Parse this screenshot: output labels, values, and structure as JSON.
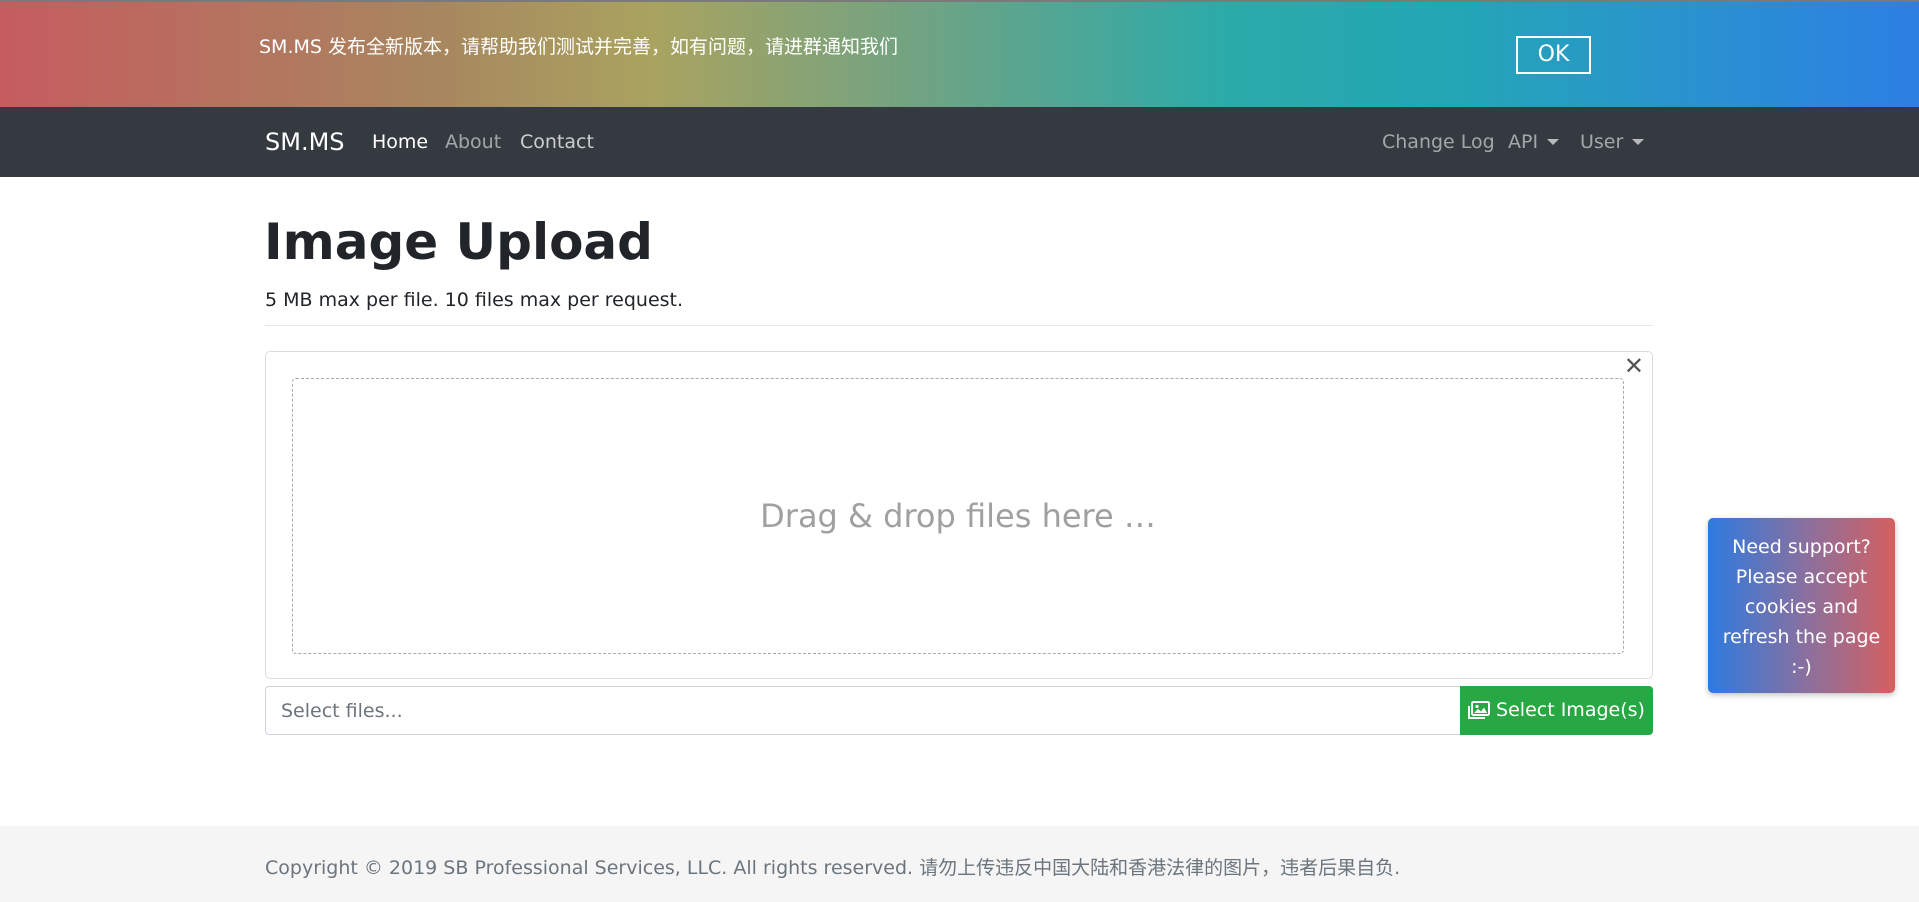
{
  "banner": {
    "message": "SM.MS 发布全新版本，请帮助我们测试并完善，如有问题，请进群通知我们",
    "ok_label": "OK"
  },
  "navbar": {
    "brand": "SM.MS",
    "links": [
      {
        "label": "Home"
      },
      {
        "label": "About"
      },
      {
        "label": "Contact"
      }
    ],
    "right": {
      "changelog": "Change Log",
      "api": "API",
      "user": "User"
    }
  },
  "main": {
    "title": "Image Upload",
    "subtitle": "5 MB max per file. 10 files max per request.",
    "close_symbol": "✕",
    "drop_text": "Drag & drop files here …",
    "file_placeholder": "Select files...",
    "select_button": "Select Image(s)"
  },
  "support": {
    "lines": [
      "Need support?",
      "Please accept",
      "cookies and",
      "refresh the page",
      ":-)"
    ]
  },
  "footer": {
    "text": "Copyright © 2019 SB Professional Services, LLC. All rights reserved. 请勿上传违反中国大陆和香港法律的图片，违者后果自负."
  },
  "colors": {
    "navbar_bg": "#343a40",
    "success": "#28a745",
    "footer_bg": "#f5f5f5"
  },
  "icons": {
    "select_button_icon": "images-icon",
    "close_icon": "close-icon",
    "dropdown": "caret-down-icon"
  }
}
